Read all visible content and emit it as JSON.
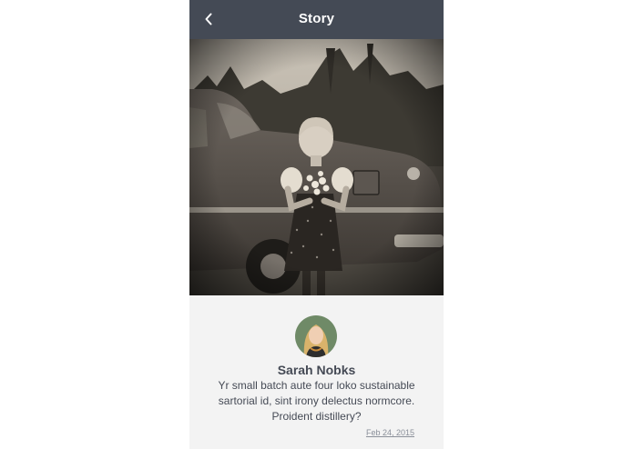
{
  "header": {
    "title": "Story",
    "back_icon": "chevron-left-icon",
    "background_color": "#444a55"
  },
  "photo": {
    "description_icon": "vintage-photo"
  },
  "story": {
    "author_name": "Sarah Nobks",
    "text": "Yr small batch aute four loko sustainable sartorial id, sint irony delectus normcore. Proident distillery?",
    "date": "Feb 24, 2015"
  }
}
